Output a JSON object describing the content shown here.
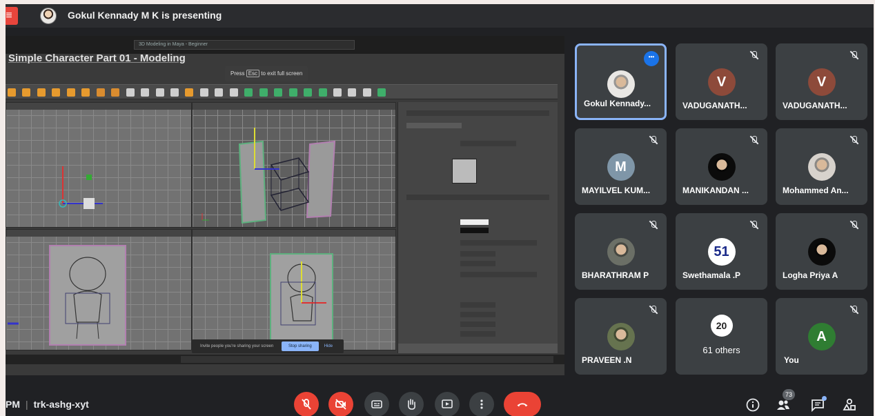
{
  "topbar": {
    "menu_icon": "menu-icon",
    "presenting_text": "Gokul Kennady M K is presenting"
  },
  "shared_screen": {
    "app_title": "Simple Character Part 01 - Modeling",
    "search_text": "3D Modeling in Maya - Beginner",
    "esc_hint": {
      "prefix": "Press",
      "key": "Esc",
      "suffix": "to exit full screen"
    },
    "share_notice": "Invite people you're sharing your screen",
    "stop_sharing_label": "Stop sharing",
    "hide_label": "Hide"
  },
  "participants": [
    {
      "name": "Gokul Kennady...",
      "avatar_type": "photo",
      "avatar_color": "#e9e7e4",
      "active": true,
      "muted": false
    },
    {
      "name": "VADUGANATH...",
      "avatar_letter": "V",
      "avatar_color": "#8d4a3a",
      "muted": true
    },
    {
      "name": "VADUGANATH...",
      "avatar_letter": "V",
      "avatar_color": "#8d4a3a",
      "muted": true
    },
    {
      "name": "MAYILVEL KUM...",
      "avatar_letter": "M",
      "avatar_color": "#7f96a8",
      "muted": true
    },
    {
      "name": "MANIKANDAN ...",
      "avatar_type": "photo",
      "avatar_color": "#0b0b0b",
      "muted": true
    },
    {
      "name": "Mohammed An...",
      "avatar_type": "photo",
      "avatar_color": "#d7d2cc",
      "muted": true
    },
    {
      "name": "BHARATHRAM P",
      "avatar_type": "photo",
      "avatar_color": "#6b6f66",
      "muted": true
    },
    {
      "name": "Swethamala .P",
      "avatar_letter": "51",
      "avatar_color": "#ffffff",
      "avatar_text_color": "#1b2b8a",
      "muted": true
    },
    {
      "name": "Logha Priya A",
      "avatar_type": "photo",
      "avatar_color": "#0b0b0b",
      "muted": true
    },
    {
      "name": "PRAVEEN .N",
      "avatar_type": "photo",
      "avatar_color": "#66734f",
      "muted": true
    },
    {
      "name": "61 others",
      "avatar_letter": "20",
      "avatar_color": "#ffffff",
      "avatar_text_color": "#222222",
      "muted": false
    },
    {
      "name": "You",
      "avatar_letter": "A",
      "avatar_color": "#2f7d32",
      "muted": true
    }
  ],
  "bottombar": {
    "time_suffix": "PM",
    "meeting_code": "trk-ashg-xyt",
    "controls": [
      {
        "name": "mic-off-icon",
        "color": "#ea4335"
      },
      {
        "name": "camera-off-icon",
        "color": "#ea4335"
      },
      {
        "name": "captions-icon",
        "color": "#3c4043"
      },
      {
        "name": "raise-hand-icon",
        "color": "#3c4043"
      },
      {
        "name": "present-screen-icon",
        "color": "#3c4043"
      },
      {
        "name": "more-options-icon",
        "color": "#3c4043"
      },
      {
        "name": "hang-up-icon",
        "color": "#ea4335"
      }
    ],
    "people_count": "73"
  }
}
